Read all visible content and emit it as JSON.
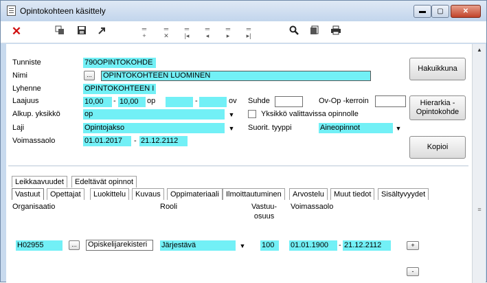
{
  "window": {
    "title": "Opintokohteen käsittely",
    "controls": {
      "minimize": "▬",
      "maximize": "▢",
      "close": "✕"
    }
  },
  "toolbar": {
    "icons": [
      "delete-icon",
      "copy-icon",
      "save-icon",
      "export-icon",
      "first-record-icon",
      "delete-record-icon",
      "first-icon",
      "previous-icon",
      "next-icon",
      "last-icon",
      "search-icon",
      "document-icon",
      "print-icon"
    ]
  },
  "form": {
    "tunniste": {
      "label": "Tunniste",
      "value": "790OPINTOKOHDE"
    },
    "nimi": {
      "label": "Nimi",
      "button": "...",
      "value": "OPINTOKOHTEEN LUOMINEN"
    },
    "lyhenne": {
      "label": "Lyhenne",
      "value": "OPINTOKOHTEEN I"
    },
    "laajuus": {
      "label": "Laajuus",
      "min": "10,00",
      "sep": "-",
      "max": "10,00",
      "unit_op": "op",
      "ov_min": "",
      "ov_sep": "-",
      "ov_max": "",
      "unit_ov": "ov"
    },
    "suhde": {
      "label": "Suhde",
      "value": ""
    },
    "ovop": {
      "label": "Ov-Op -kerroin",
      "value": ""
    },
    "alkup": {
      "label": "Alkup. yksikkö",
      "value": "op"
    },
    "yksikko_check": {
      "label": "Yksikkö valittavissa opinnolle",
      "checked": false
    },
    "laji": {
      "label": "Laji",
      "value": "Opintojakso"
    },
    "suorit": {
      "label": "Suorit. tyyppi",
      "value": "Aineopinnot"
    },
    "voimassaolo": {
      "label": "Voimassaolo",
      "start": "01.01.2017",
      "sep": "-",
      "end": "21.12.2112"
    }
  },
  "side_buttons": {
    "hakuikkuna": "Hakuikkuna",
    "hierarkia_line1": "Hierarkia -",
    "hierarkia_line2": "Opintokohde",
    "kopioi": "Kopioi"
  },
  "tabs_top": [
    "Leikkaavuudet",
    "Edeltävät opinnot"
  ],
  "tabs_bottom": [
    "Vastuut",
    "Opettajat",
    "Luokittelu",
    "Kuvaus",
    "Oppimateriaali",
    "Ilmoittautuminen",
    "Arvostelu",
    "Muut tiedot",
    "Sisältyvyydet"
  ],
  "active_tab": "Vastuut",
  "columns": {
    "organisaatio": "Organisaatio",
    "rooli": "Rooli",
    "vastuu_line1": "Vastuu-",
    "vastuu_line2": "osuus",
    "voimassaolo": "Voimassaolo"
  },
  "row": {
    "organisaatio": "H02955",
    "button": "...",
    "organisaatio_name": "Opiskelijarekisteri",
    "rooli": "Järjestävä",
    "vastuu": "100",
    "start": "01.01.1900",
    "sep": "-",
    "end": "21.12.2112"
  },
  "row_buttons": {
    "add": "+",
    "remove": "-"
  },
  "colors": {
    "field": "#72f0f6",
    "window_frame": "#c8daee",
    "close_button": "#c1432a"
  }
}
